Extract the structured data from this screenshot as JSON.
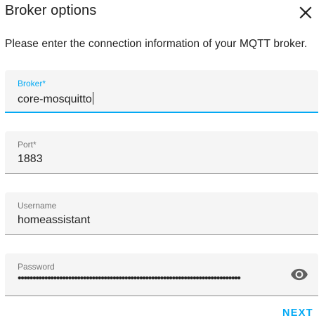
{
  "dialog": {
    "title": "Broker options",
    "description": "Please enter the connection information of your MQTT broker.",
    "close_icon": "close-icon"
  },
  "fields": {
    "broker": {
      "label": "Broker*",
      "value": "core-mosquitto"
    },
    "port": {
      "label": "Port*",
      "value": "1883"
    },
    "username": {
      "label": "Username",
      "value": "homeassistant"
    },
    "password": {
      "label": "Password",
      "masked_value": "•••••••••••••••••••••••••••••••••••••••••••••••••••••••••••••••••••••••••••",
      "toggle_icon": "eye-icon"
    }
  },
  "actions": {
    "next_label": "NEXT"
  },
  "colors": {
    "accent": "#03a9f4",
    "field_bg": "#f5f5f5",
    "label": "#757575",
    "text": "#212121"
  }
}
